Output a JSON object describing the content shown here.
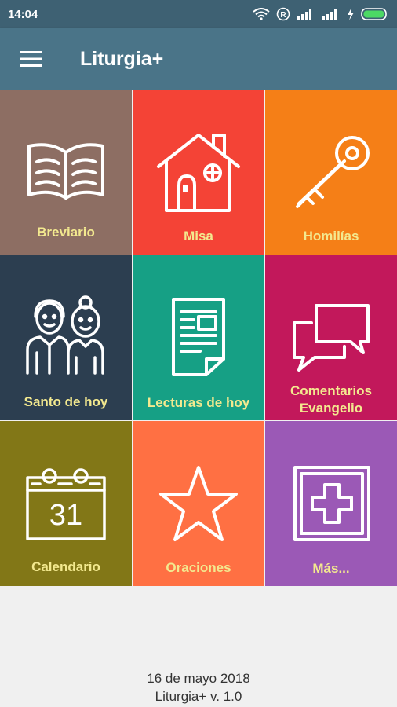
{
  "status_bar": {
    "time": "14:04",
    "icons": [
      "wifi-icon",
      "registered-icon",
      "signal-icon",
      "signal-icon",
      "charging-icon",
      "battery-icon"
    ]
  },
  "app_bar": {
    "title": "Liturgia+",
    "menu_icon": "hamburger-menu-icon"
  },
  "tiles": [
    {
      "label": "Breviario",
      "color": "#8d6e63",
      "icon": "open-book-icon"
    },
    {
      "label": "Misa",
      "color": "#f44336",
      "icon": "house-icon"
    },
    {
      "label": "Homilías",
      "color": "#f57f17",
      "icon": "key-icon"
    },
    {
      "label": "Santo de hoy",
      "color": "#2c3e50",
      "icon": "couple-icon"
    },
    {
      "label": "Lecturas de hoy",
      "color": "#16a085",
      "icon": "document-icon"
    },
    {
      "label_line1": "Comentarios",
      "label_line2": "Evangelio",
      "color": "#c2185b",
      "icon": "chat-bubbles-icon"
    },
    {
      "label": "Calendario",
      "color": "#827717",
      "icon": "calendar-icon",
      "calendar_day": "31"
    },
    {
      "label": "Oraciones",
      "color": "#ff7043",
      "icon": "star-icon"
    },
    {
      "label": "Más...",
      "color": "#9b59b6",
      "icon": "plus-square-icon"
    }
  ],
  "footer": {
    "date": "16 de mayo 2018",
    "version": "Liturgia+ v. 1.0"
  }
}
